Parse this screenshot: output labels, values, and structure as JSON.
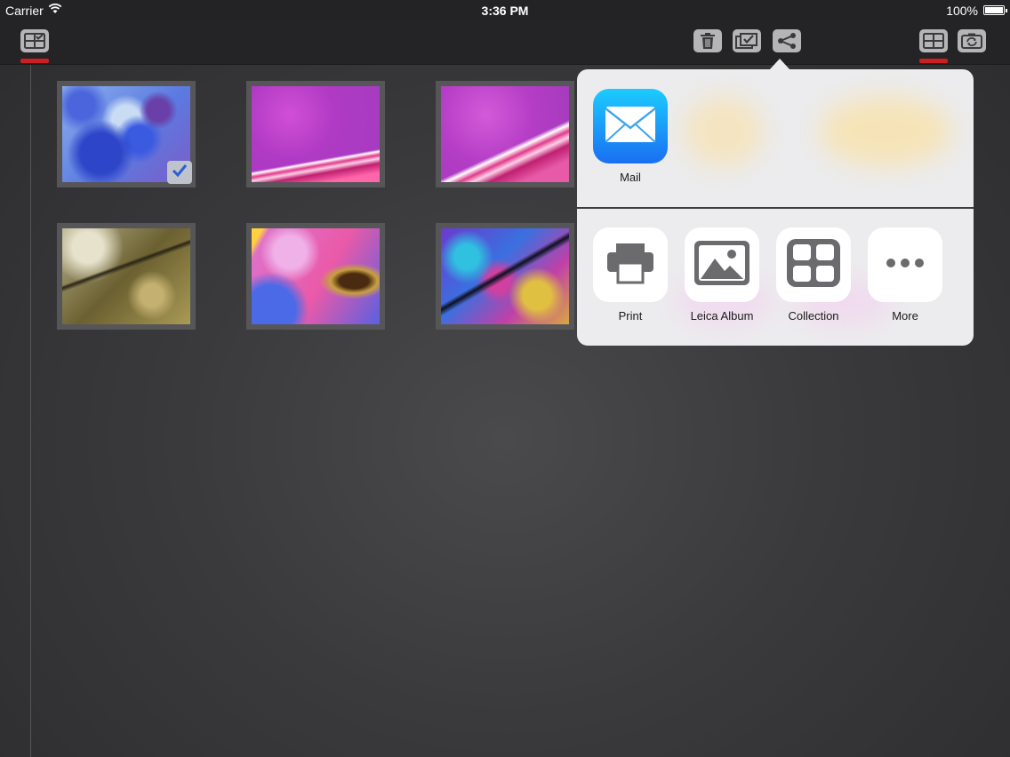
{
  "status_bar": {
    "carrier": "Carrier",
    "time": "3:36 PM",
    "battery": "100%"
  },
  "toolbar": {
    "left": [
      "select-grid-icon"
    ],
    "center": [
      "trash-icon",
      "select-all-icon",
      "share-icon"
    ],
    "right": [
      "grid-view-icon",
      "camera-switch-icon"
    ],
    "indicator_color": "#cc1f1f"
  },
  "gallery": {
    "thumbnails": [
      {
        "name": "blue-cells",
        "selected": true
      },
      {
        "name": "pink-tissue-1",
        "selected": false
      },
      {
        "name": "pink-tissue-2",
        "selected": false
      },
      {
        "name": "olive-mineral",
        "selected": false
      },
      {
        "name": "pink-crystal",
        "selected": false
      },
      {
        "name": "multicolor-crystal",
        "selected": false
      }
    ]
  },
  "share_sheet": {
    "top_row": [
      {
        "label": "Mail",
        "icon": "mail-icon"
      }
    ],
    "actions": [
      {
        "label": "Print",
        "icon": "print-icon"
      },
      {
        "label": "Leica Album",
        "icon": "photo-album-icon"
      },
      {
        "label": "Collection",
        "icon": "collection-icon"
      },
      {
        "label": "More",
        "icon": "more-icon"
      }
    ]
  }
}
